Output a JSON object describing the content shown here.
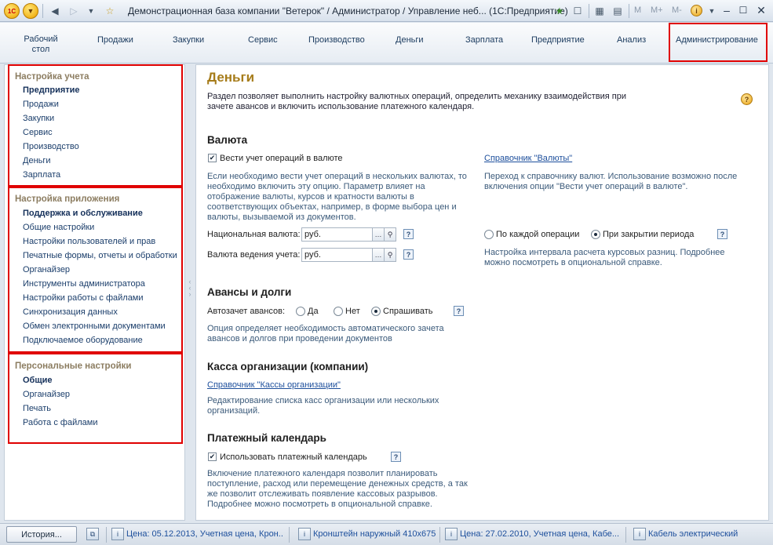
{
  "window": {
    "title": "Демонстрационная база компании \"Ветерок\" / Администратор / Управление неб... (1С:Предприятие)",
    "logo_text": "1С",
    "m_buttons": [
      "M",
      "M+",
      "M-"
    ]
  },
  "sections": [
    {
      "label": "Рабочий стол",
      "line1": "Рабочий",
      "line2": "стол"
    },
    {
      "label": "Продажи"
    },
    {
      "label": "Закупки"
    },
    {
      "label": "Сервис"
    },
    {
      "label": "Производство"
    },
    {
      "label": "Деньги"
    },
    {
      "label": "Зарплата"
    },
    {
      "label": "Предприятие"
    },
    {
      "label": "Анализ"
    },
    {
      "label": "Администрирование"
    }
  ],
  "nav": {
    "group1": {
      "title": "Настройка учета",
      "items": [
        "Предприятие",
        "Продажи",
        "Закупки",
        "Сервис",
        "Производство",
        "Деньги",
        "Зарплата"
      ]
    },
    "group2": {
      "title": "Настройка приложения",
      "items": [
        "Поддержка и обслуживание",
        "Общие настройки",
        "Настройки пользователей и прав",
        "Печатные формы, отчеты и обработки",
        "Органайзер",
        "Инструменты администратора",
        "Настройки работы с файлами",
        "Синхронизация данных",
        "Обмен электронными документами",
        "Подключаемое оборудование"
      ]
    },
    "group3": {
      "title": "Персональные настройки",
      "items": [
        "Общие",
        "Органайзер",
        "Печать",
        "Работа с файлами"
      ]
    }
  },
  "main": {
    "title": "Деньги",
    "intro_line1": "Раздел позволяет выполнить настройку валютных операций,  определить механику взаимодействия при",
    "intro_line2": "зачете авансов и включить использование платежного календаря.",
    "currency": {
      "heading": "Валюта",
      "checkbox_label": "Вести учет операций в валюте",
      "checkbox_checked": true,
      "hint": "Если необходимо вести учет операций в нескольких валютах, то необходимо включить эту опцию. Параметр влияет на отображение валюты, курсов и кратности валюты в соответствующих объектах, например, в форме выбора цен и валюты, вызываемой из документов.",
      "link": "Справочник \"Валюты\"",
      "link_hint": "Переход к справочнику валют. Использование возможно после включения опции \"Вести учет операций в валюте\".",
      "national_label": "Национальная валюта:",
      "national_value": "руб.",
      "accounting_label": "Валюта ведения учета:",
      "accounting_value": "руб.",
      "radio_each": "По каждой операции",
      "radio_close": "При закрытии периода",
      "radio_selected": "При закрытии периода",
      "radio_hint": "Настройка интервала расчета курсовых разниц. Подробнее можно посмотреть в опциональной справке."
    },
    "advances": {
      "heading": "Авансы и долги",
      "label": "Автозачет авансов:",
      "yes": "Да",
      "no": "Нет",
      "ask": "Спрашивать",
      "selected": "Спрашивать",
      "hint": "Опция определяет необходимость автоматического зачета авансов и долгов при проведении документов"
    },
    "cash": {
      "heading": "Касса организации (компании)",
      "link": "Справочник \"Кассы организации\"",
      "hint": "Редактирование списка касс организации или нескольких организаций."
    },
    "calendar": {
      "heading": "Платежный календарь",
      "checkbox_label": "Использовать платежный календарь",
      "checkbox_checked": true,
      "hint": "Включение платежного календаря позволит планировать поступление, расход или перемещение денежных средств, а так же позволит отслеживать появление кассовых разрывов. Подробнее можно посмотреть в опциональной справке."
    }
  },
  "statusbar": {
    "history_button": "История...",
    "items": [
      "Цена: 05.12.2013, Учетная цена, Крон...",
      "Кронштейн наружный 410х675",
      "Цена: 27.02.2010, Учетная цена, Кабе...",
      "Кабель электрический"
    ]
  },
  "colors": {
    "highlight_border": "#e00000",
    "heading_gold": "#a67c1a",
    "link_blue": "#1d4f9c"
  }
}
